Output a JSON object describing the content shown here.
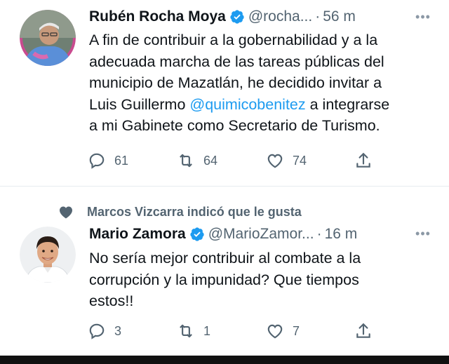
{
  "tweets": [
    {
      "author_name": "Rubén Rocha Moya",
      "handle": "@rocha...",
      "separator": "·",
      "time": "56 m",
      "text_before": "A fin de contribuir a la gobernabilidad y a la\nadecuada marcha de las tareas públicas del\nmunicipio de Mazatlán, he decidido invitar a\nLuis Guillermo ",
      "mention": "@quimicobenitez",
      "text_after": " a integrarse\na mi Gabinete como Secretario de Turismo.",
      "replies": "61",
      "retweets": "64",
      "likes": "74",
      "icons": [
        "reply-icon",
        "retweet-icon",
        "like-icon",
        "share-icon"
      ]
    },
    {
      "social_context": "Marcos Vizcarra indicó que le gusta",
      "author_name": "Mario Zamora",
      "handle": "@MarioZamor...",
      "separator": "·",
      "time": "16 m",
      "text": "No sería mejor contribuir al combate a la\ncorrupción y la impunidad? Que tiempos\nestos!!",
      "replies": "3",
      "retweets": "1",
      "likes": "7",
      "icons": [
        "reply-icon",
        "retweet-icon",
        "like-icon",
        "share-icon"
      ]
    }
  ],
  "more_label": "•••",
  "colors": {
    "text": "#0f1419",
    "secondary": "#536471",
    "accent": "#1d9bf0",
    "verified": "#1d9bf0",
    "divider": "#e6ecf0"
  }
}
